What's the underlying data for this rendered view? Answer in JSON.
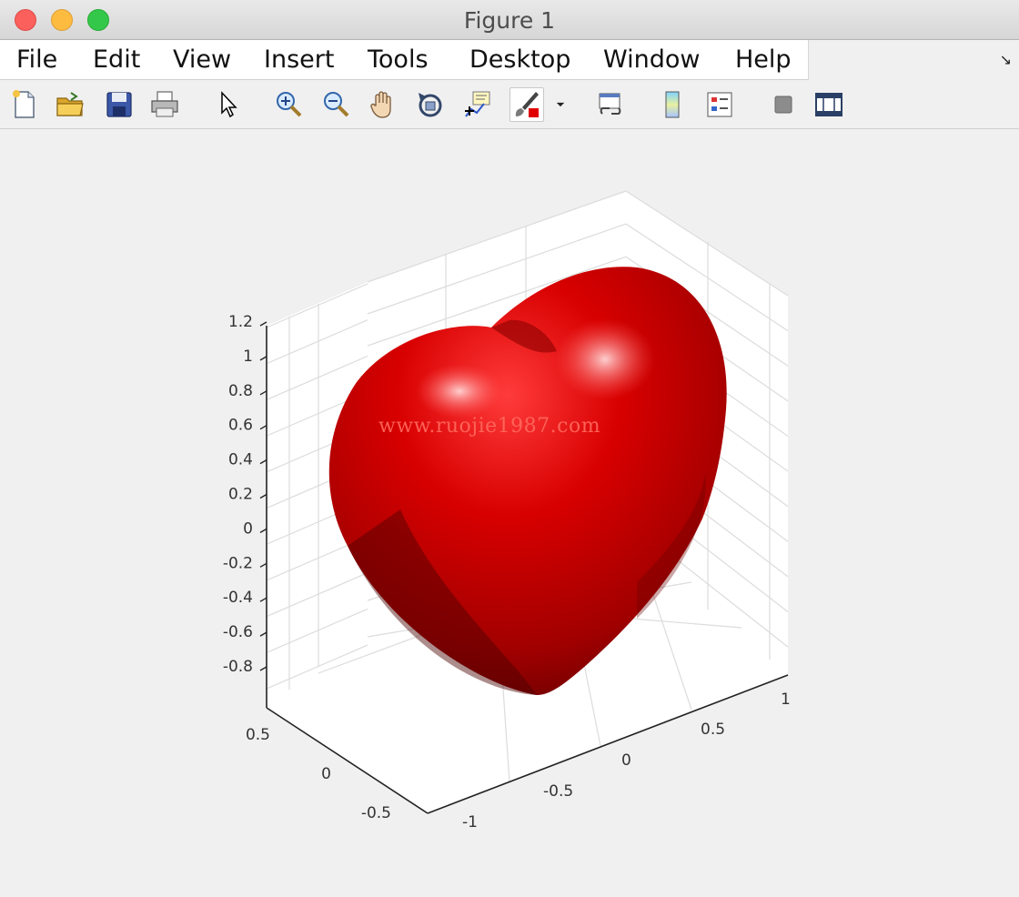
{
  "window": {
    "title": "Figure 1"
  },
  "menu": {
    "items": [
      "File",
      "Edit",
      "View",
      "Insert",
      "Tools",
      "Desktop",
      "Window",
      "Help"
    ],
    "dock_icon": "dock-arrow-icon"
  },
  "toolbar": {
    "buttons": [
      {
        "icon": "new-figure-icon"
      },
      {
        "icon": "open-file-icon"
      },
      {
        "icon": "save-icon"
      },
      {
        "icon": "print-icon"
      },
      {
        "icon": "edit-plot-pointer-icon"
      },
      {
        "icon": "zoom-in-icon"
      },
      {
        "icon": "zoom-out-icon"
      },
      {
        "icon": "pan-hand-icon"
      },
      {
        "icon": "rotate-3d-icon"
      },
      {
        "icon": "data-cursor-icon"
      },
      {
        "icon": "brush-icon",
        "pressed": true
      },
      {
        "icon": "brush-dropdown-icon"
      },
      {
        "icon": "link-plot-icon"
      },
      {
        "icon": "insert-colorbar-icon"
      },
      {
        "icon": "insert-legend-icon"
      },
      {
        "icon": "hide-plot-tools-icon"
      },
      {
        "icon": "show-plot-tools-icon"
      }
    ]
  },
  "chart_data": {
    "type": "surface",
    "description_shape": "heart",
    "surface_color": "#d40000",
    "z_ticks": [
      "1.2",
      "1",
      "0.8",
      "0.6",
      "0.4",
      "0.2",
      "0",
      "-0.2",
      "-0.4",
      "-0.6",
      "-0.8"
    ],
    "y_ticks": [
      "0.5",
      "0",
      "-0.5"
    ],
    "x_ticks": [
      "1",
      "0.5",
      "0",
      "-0.5",
      "-1"
    ],
    "grid": true,
    "box": true
  },
  "watermark": {
    "text": "www.ruojie1987.com"
  }
}
